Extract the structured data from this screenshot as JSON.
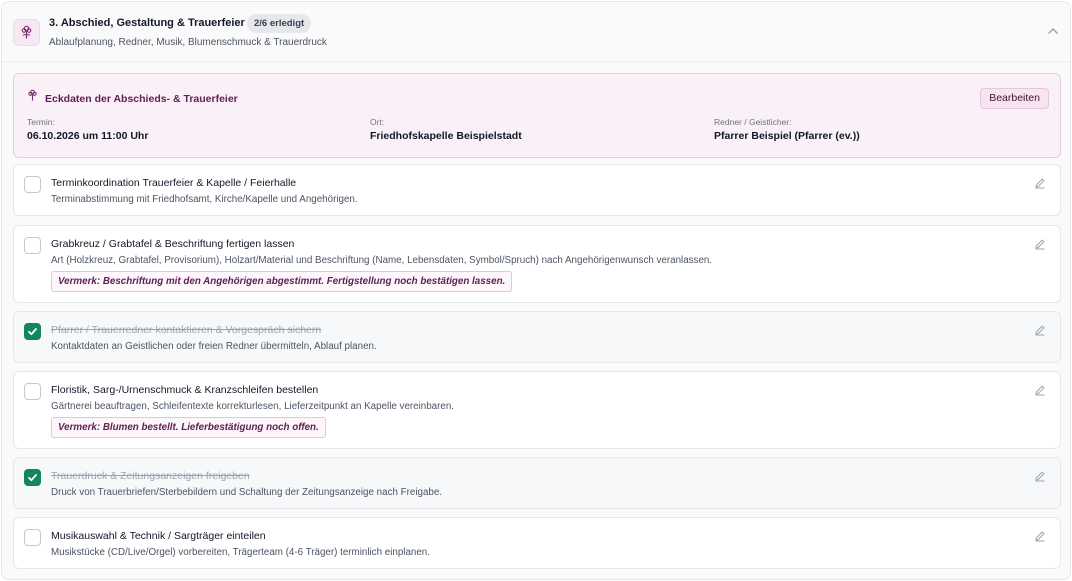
{
  "section": {
    "icon": "flower-icon",
    "title": "3. Abschied, Gestaltung & Trauerfeier",
    "progress": "2/6 erledigt",
    "subtitle": "Ablaufplanung, Redner, Musik, Blumenschmuck & Trauerdruck",
    "collapse_icon": "chevron-up-icon"
  },
  "details": {
    "icon": "flower-icon",
    "title": "Eckdaten der Abschieds- & Trauerfeier",
    "edit_label": "Bearbeiten",
    "fields": [
      {
        "label": "Termin:",
        "value": "06.10.2026 um 11:00 Uhr"
      },
      {
        "label": "Ort:",
        "value": "Friedhofskapelle Beispielstadt"
      },
      {
        "label": "Redner / Geistlicher:",
        "value": "Pfarrer Beispiel (Pfarrer (ev.))"
      }
    ]
  },
  "tasks": [
    {
      "title": "Terminkoordination Trauerfeier & Kapelle / Feierhalle",
      "description": "Terminabstimmung mit Friedhofsamt, Kirche/Kapelle und Angehörigen.",
      "done": false,
      "note": ""
    },
    {
      "title": "Grabkreuz / Grabtafel & Beschriftung fertigen lassen",
      "description": "Art (Holzkreuz, Grabtafel, Provisorium), Holzart/Material und Beschriftung (Name, Lebensdaten, Symbol/Spruch) nach Angehörigenwunsch veranlassen.",
      "done": false,
      "note": "Vermerk: Beschriftung mit den Angehörigen abgestimmt. Fertigstellung noch bestätigen lassen."
    },
    {
      "title": "Pfarrer / Trauerredner kontaktieren & Vorgespräch sichern",
      "description": "Kontaktdaten an Geistlichen oder freien Redner übermitteln, Ablauf planen.",
      "done": true,
      "note": ""
    },
    {
      "title": "Floristik, Sarg-/Urnenschmuck & Kranzschleifen bestellen",
      "description": "Gärtnerei beauftragen, Schleifentexte korrekturlesen, Lieferzeitpunkt an Kapelle vereinbaren.",
      "done": false,
      "note": "Vermerk: Blumen bestellt. Lieferbestätigung noch offen."
    },
    {
      "title": "Trauerdruck & Zeitungsanzeigen freigeben",
      "description": "Druck von Trauerbriefen/Sterbebildern und Schaltung der Zeitungsanzeige nach Freigabe.",
      "done": true,
      "note": ""
    },
    {
      "title": "Musikauswahl & Technik / Sargträger einteilen",
      "description": "Musikstücke (CD/Live/Orgel) vorbereiten, Trägerteam (4-6 Träger) terminlich einplanen.",
      "done": false,
      "note": ""
    }
  ],
  "colors": {
    "accent": "#7d2b6d",
    "checked": "#13855f",
    "card_bg": "#faf0f8"
  }
}
